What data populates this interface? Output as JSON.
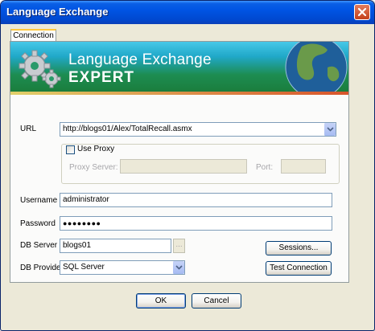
{
  "window": {
    "title": "Language Exchange"
  },
  "tabs": [
    {
      "label": "Connection"
    }
  ],
  "banner": {
    "line1": "Language Exchange",
    "line2": "EXPERT"
  },
  "form": {
    "url": {
      "label": "URL",
      "value": "http://blogs01/Alex/TotalRecall.asmx"
    },
    "use_proxy": {
      "label": "Use Proxy",
      "checked": false
    },
    "proxy_server": {
      "label": "Proxy Server:",
      "value": ""
    },
    "proxy_port": {
      "label": "Port:",
      "value": ""
    },
    "username": {
      "label": "Username",
      "value": "administrator"
    },
    "password": {
      "label": "Password",
      "value": "●●●●●●●●"
    },
    "db_server": {
      "label": "DB Server",
      "value": "blogs01",
      "browse_label": "..."
    },
    "db_provider": {
      "label": "DB Provider",
      "value": "SQL Server"
    }
  },
  "buttons": {
    "sessions": "Sessions...",
    "test_connection": "Test Connection",
    "ok": "OK",
    "cancel": "Cancel"
  },
  "colors": {
    "title_bar": "#0054e3",
    "banner_green": "#1d8d52",
    "banner_cyan": "#46c8e8",
    "close_red": "#c4401a"
  },
  "icons": [
    "close-icon",
    "gears-icon",
    "globe-icon",
    "chevron-down-icon"
  ]
}
